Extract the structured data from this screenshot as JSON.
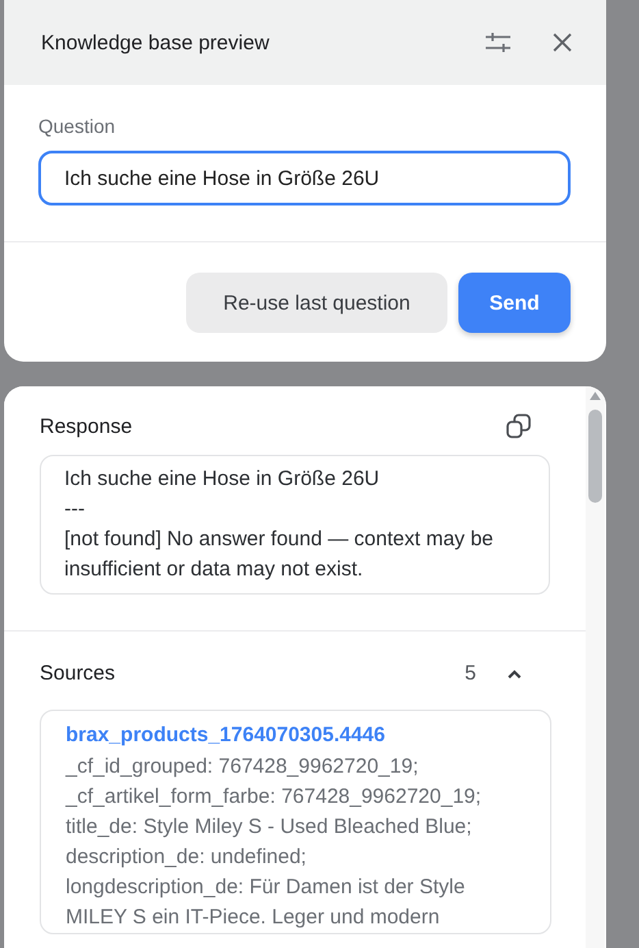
{
  "dialog": {
    "title": "Knowledge base preview"
  },
  "question": {
    "label": "Question",
    "value": "Ich suche eine Hose in Größe 26U"
  },
  "buttons": [
    {
      "label": "Re-use last question",
      "kind": "secondary"
    },
    {
      "label": "Send",
      "kind": "primary"
    }
  ],
  "response": {
    "title": "Response",
    "text": "Ich suche eine Hose in Größe 26U\n---\n[not found] No answer found — context may be insufficient or data may not exist."
  },
  "sources": {
    "title": "Sources",
    "count": "5",
    "expanded": true,
    "items": [
      {
        "name": "brax_products_1764070305.4446",
        "text": "_cf_id_grouped: 767428_9962720_19;\n_cf_artikel_form_farbe: 767428_9962720_19;\ntitle_de: Style Miley S - Used Bleached Blue;\ndescription_de: undefined;\nlongdescription_de: Für Damen ist der Style\nMILEY S ein IT-Piece. Leger und modern"
      }
    ]
  }
}
